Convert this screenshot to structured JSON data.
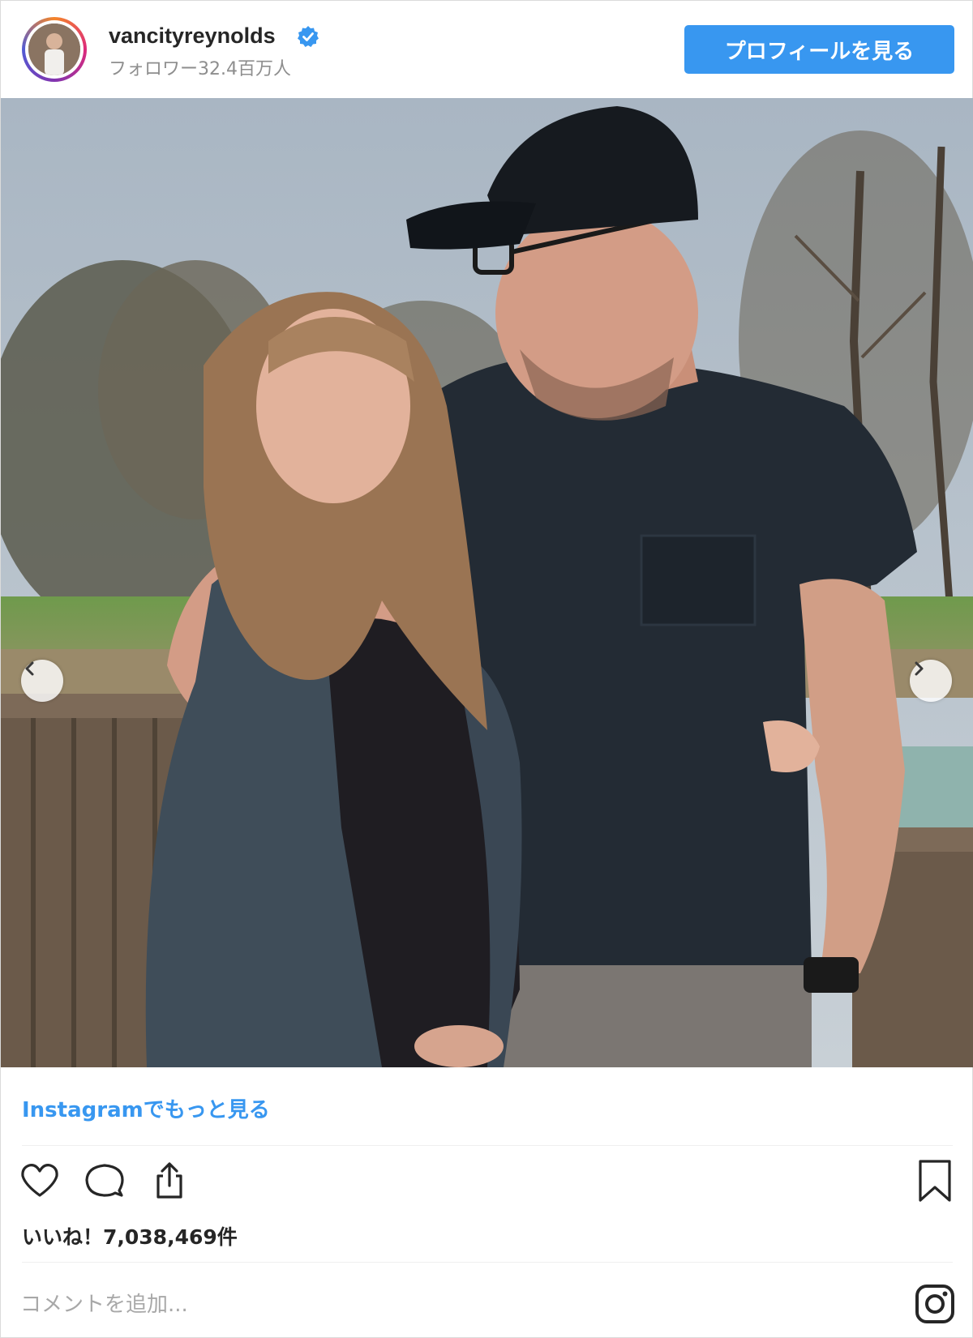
{
  "header": {
    "username": "vancityreynolds",
    "followers": "フォロワー32.4百万人",
    "profile_button": "プロフィールを見る",
    "verified_icon": "verified-badge-icon",
    "avatar_icon": "profile-avatar"
  },
  "post": {
    "image_icon": "post-photo",
    "nav_prev_icon": "chevron-left-icon",
    "nav_next_icon": "chevron-right-icon"
  },
  "footer": {
    "more_link": "Instagramでもっと見る",
    "likes": "いいね！7,038,469件",
    "comment_placeholder": "コメントを追加...",
    "icons": [
      "heart-icon",
      "comment-icon",
      "share-icon",
      "bookmark-icon",
      "instagram-logo-icon"
    ]
  },
  "colors": {
    "accent": "#3897f0",
    "text": "#262626",
    "muted": "#8e8e8e"
  }
}
